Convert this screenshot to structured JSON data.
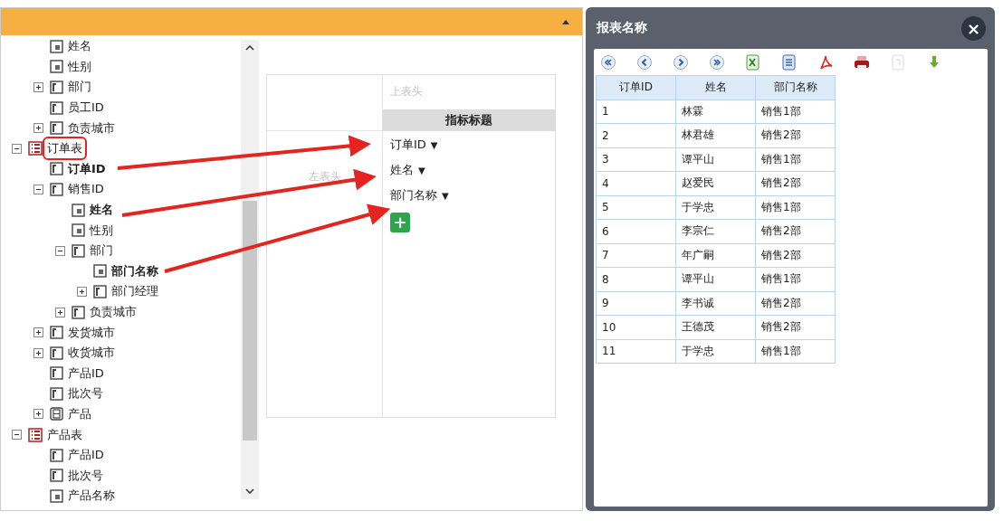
{
  "tree": {
    "scrolled_branch": [
      {
        "label": "姓名",
        "kind": "attr",
        "used": false
      },
      {
        "label": "性别",
        "kind": "attr",
        "used": false
      },
      {
        "label": "部门",
        "kind": "key",
        "used": false,
        "expanded": false
      },
      {
        "label": "员工ID",
        "kind": "key",
        "used": false
      },
      {
        "label": "负责城市",
        "kind": "key",
        "used": false,
        "expanded": false
      }
    ],
    "roots": [
      {
        "label": "订单表",
        "kind": "table",
        "used": false,
        "expanded": true,
        "highlighted": true,
        "children": [
          {
            "label": "订单ID",
            "kind": "key",
            "used": true
          },
          {
            "label": "销售ID",
            "kind": "key",
            "used": false,
            "expanded": true,
            "children": [
              {
                "label": "姓名",
                "kind": "attr",
                "used": true
              },
              {
                "label": "性别",
                "kind": "attr",
                "used": false
              },
              {
                "label": "部门",
                "kind": "key",
                "used": false,
                "expanded": true,
                "children": [
                  {
                    "label": "部门名称",
                    "kind": "attr",
                    "used": true
                  },
                  {
                    "label": "部门经理",
                    "kind": "key",
                    "used": false,
                    "expanded": false
                  }
                ]
              },
              {
                "label": "负责城市",
                "kind": "key",
                "used": false,
                "expanded": false
              }
            ]
          },
          {
            "label": "发货城市",
            "kind": "key",
            "used": false,
            "expanded": false
          },
          {
            "label": "收货城市",
            "kind": "key",
            "used": false,
            "expanded": false
          },
          {
            "label": "产品ID",
            "kind": "key",
            "used": false
          },
          {
            "label": "批次号",
            "kind": "key",
            "used": false
          },
          {
            "label": "产品",
            "kind": "group",
            "used": false,
            "expanded": false
          }
        ]
      },
      {
        "label": "产品表",
        "kind": "table",
        "used": false,
        "expanded": true,
        "highlighted": false,
        "children": [
          {
            "label": "产品ID",
            "kind": "key",
            "used": false
          },
          {
            "label": "批次号",
            "kind": "key",
            "used": false
          },
          {
            "label": "产品名称",
            "kind": "attr",
            "used": false
          }
        ]
      }
    ]
  },
  "pivot": {
    "top_header_placeholder": "上表头",
    "metric_header": "指标标题",
    "left_header_placeholder": "左表头",
    "metrics": [
      {
        "label": "订单ID",
        "caret": "▼"
      },
      {
        "label": "姓名",
        "caret": "▼"
      },
      {
        "label": "部门名称",
        "caret": "▼"
      }
    ],
    "add_button": "+"
  },
  "dialog": {
    "title": "报表名称",
    "close": "×",
    "toolbar": [
      {
        "kind": "first",
        "disabled": false
      },
      {
        "kind": "prev",
        "disabled": false
      },
      {
        "kind": "next",
        "disabled": false
      },
      {
        "kind": "last",
        "disabled": false
      },
      {
        "kind": "excel",
        "disabled": false
      },
      {
        "kind": "word",
        "disabled": false
      },
      {
        "kind": "pdf",
        "disabled": false
      },
      {
        "kind": "print",
        "disabled": false
      },
      {
        "kind": "doc",
        "disabled": true
      },
      {
        "kind": "download",
        "disabled": false
      }
    ],
    "table": {
      "columns": [
        "订单ID",
        "姓名",
        "部门名称"
      ],
      "rows": [
        [
          "1",
          "林霖",
          "销售1部"
        ],
        [
          "2",
          "林君雄",
          "销售2部"
        ],
        [
          "3",
          "谭平山",
          "销售1部"
        ],
        [
          "4",
          "赵爱民",
          "销售2部"
        ],
        [
          "5",
          "于学忠",
          "销售1部"
        ],
        [
          "6",
          "李宗仁",
          "销售2部"
        ],
        [
          "7",
          "年广嗣",
          "销售2部"
        ],
        [
          "8",
          "谭平山",
          "销售1部"
        ],
        [
          "9",
          "李书诚",
          "销售2部"
        ],
        [
          "10",
          "王德茂",
          "销售2部"
        ],
        [
          "11",
          "于学忠",
          "销售1部"
        ]
      ]
    }
  }
}
